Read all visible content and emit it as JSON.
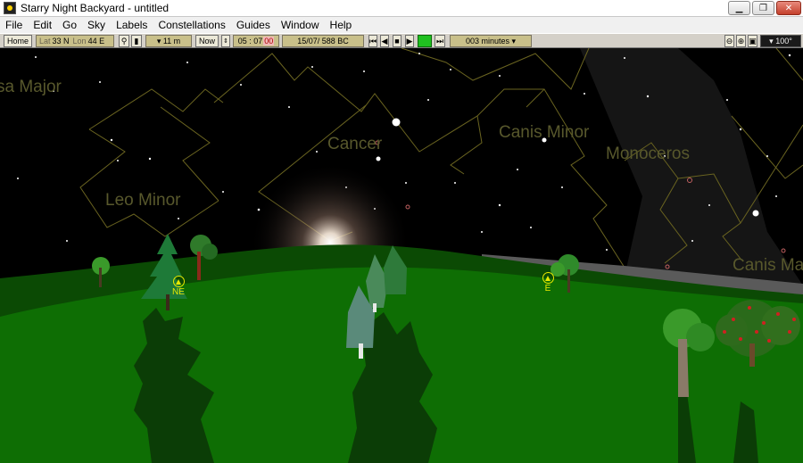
{
  "window": {
    "title": "Starry Night Backyard - untitled"
  },
  "menu": [
    "File",
    "Edit",
    "Go",
    "Sky",
    "Labels",
    "Constellations",
    "Guides",
    "Window",
    "Help"
  ],
  "toolbar": {
    "home": "Home",
    "lat_label": "Lat",
    "lat_value": "33 N",
    "lon_label": "Lon",
    "lon_value": "44 E",
    "elevation": "▾ 11 m",
    "now": "Now",
    "time": "05 : 07",
    "seconds": "00",
    "date": "15/07/   588 BC",
    "time_step": "003 minutes ▾",
    "field_of_view": "▾ 100°"
  },
  "sky": {
    "constellations": [
      "sa Major",
      "Leo Minor",
      "Cancer",
      "Canis Minor",
      "Monoceros",
      "Canis Ma"
    ],
    "directions": [
      "NE",
      "E"
    ]
  },
  "colors": {
    "sky": "#000000",
    "ground": "#0e6e04",
    "far_ground": "#0b4a04",
    "constellation_line": "#6a6420",
    "label": "#58582c",
    "direction_marker": "#e8e800"
  }
}
